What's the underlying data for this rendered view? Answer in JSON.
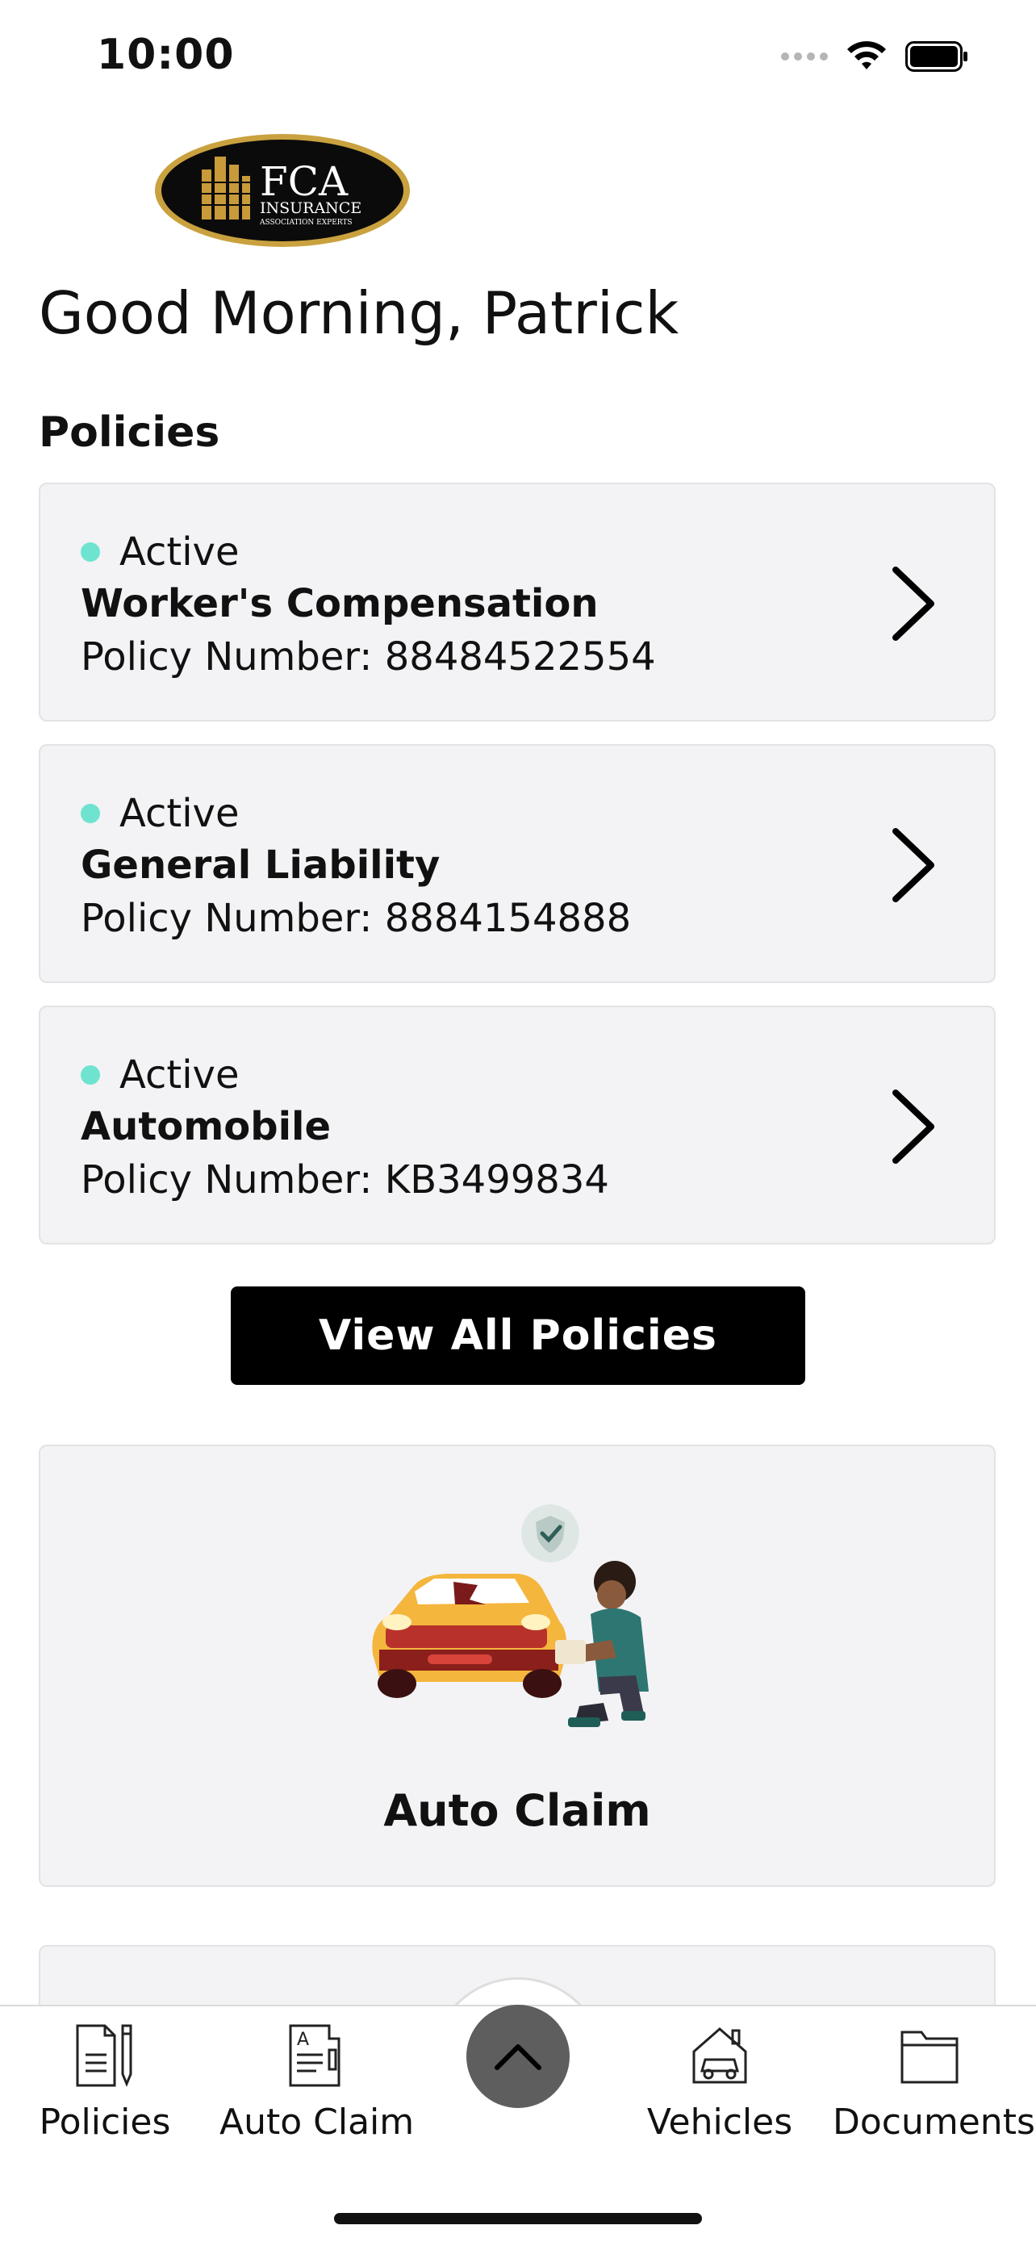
{
  "status_bar": {
    "time": "10:00"
  },
  "header": {
    "greeting": "Good Morning, Patrick"
  },
  "logo": {
    "text": "FCA",
    "subtext": "INSURANCE",
    "tagline": "ASSOCIATION EXPERTS"
  },
  "policies": {
    "title": "Policies",
    "items": [
      {
        "status": "Active",
        "name": "Worker's Compensation",
        "number": "Policy Number: 88484522554"
      },
      {
        "status": "Active",
        "name": "General Liability",
        "number": "Policy Number: 8884154888"
      },
      {
        "status": "Active",
        "name": "Automobile",
        "number": "Policy Number: KB3499834"
      }
    ],
    "view_all_label": "View All Policies"
  },
  "claim_card": {
    "label": "Auto Claim"
  },
  "tab_bar": {
    "tabs": [
      {
        "label": "Policies",
        "icon": "policies-icon"
      },
      {
        "label": "Auto Claim",
        "icon": "auto-claim-icon"
      },
      {
        "label": "Vehicles",
        "icon": "vehicles-icon"
      },
      {
        "label": "Documents",
        "icon": "documents-icon"
      }
    ],
    "center_icon": "chevron-up-icon"
  },
  "colors": {
    "active_dot": "#6ee3cf",
    "card_bg": "#f3f3f5",
    "button_bg": "#000000",
    "center_button": "#5e5e5e"
  }
}
